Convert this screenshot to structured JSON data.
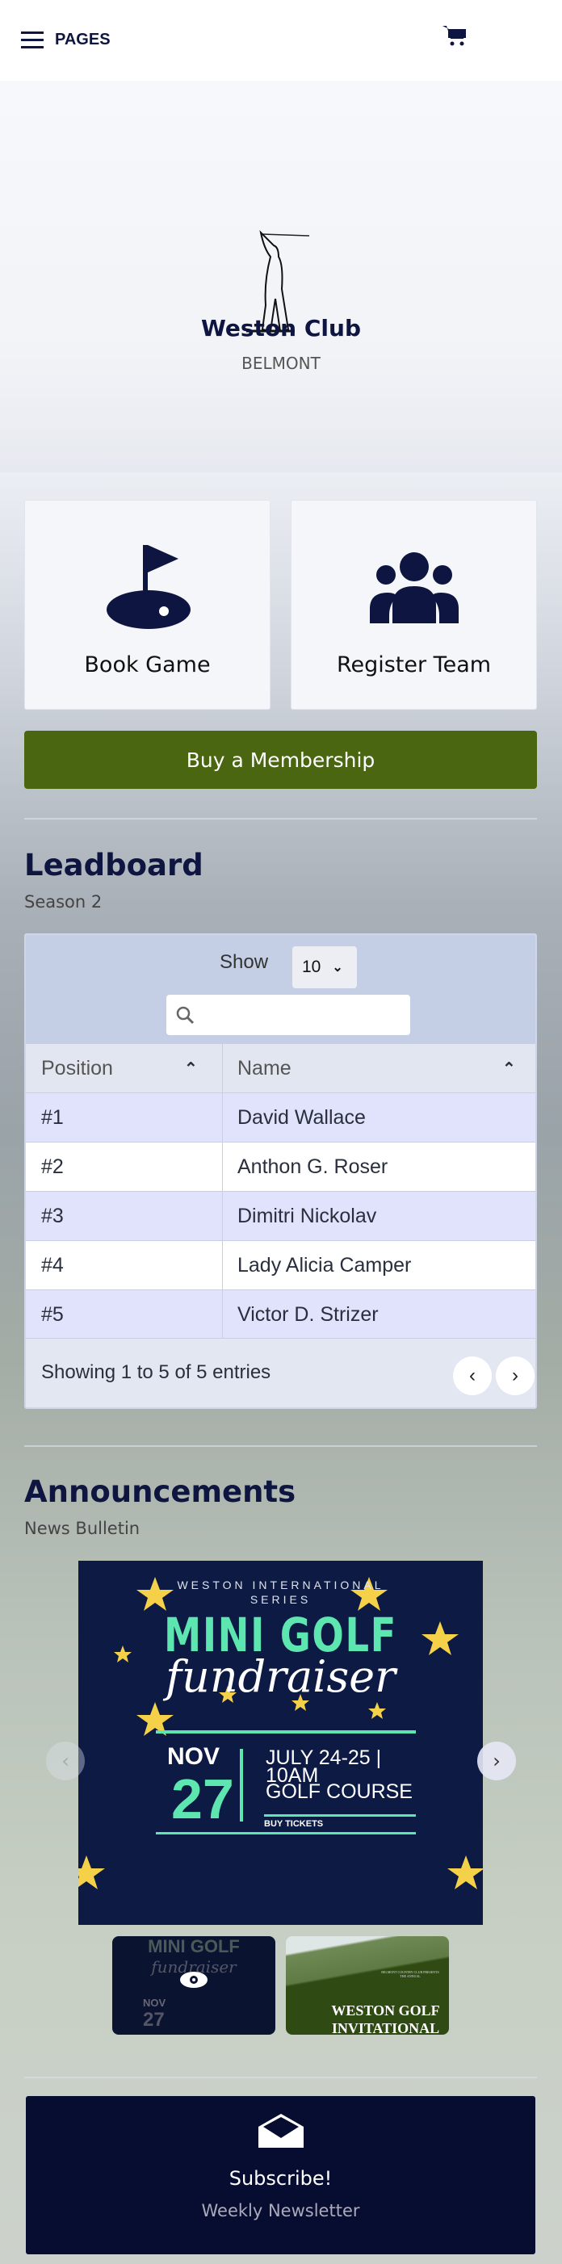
{
  "header": {
    "menu_label": "PAGES",
    "menu_icon": "hamburger-icon",
    "cart_icon": "cart-icon"
  },
  "hero": {
    "title": "Weston Club",
    "subtitle": "BELMONT"
  },
  "actions": [
    {
      "label": "Book Game",
      "icon": "golf-flag-icon"
    },
    {
      "label": "Register Team",
      "icon": "users-icon"
    }
  ],
  "membership_button": "Buy a Membership",
  "leaderboard": {
    "title": "Leadboard",
    "subtitle": "Season 2",
    "show_label": "Show",
    "page_size": "10",
    "search_placeholder": "",
    "columns": [
      "Position",
      "Name"
    ],
    "rows": [
      [
        "#1",
        "David Wallace"
      ],
      [
        "#2",
        "Anthon G. Roser"
      ],
      [
        "#3",
        "Dimitri Nickolav"
      ],
      [
        "#4",
        "Lady Alicia Camper"
      ],
      [
        "#5",
        "Victor D. Strizer"
      ]
    ],
    "info": "Showing 1 to 5 of 5 entries"
  },
  "announcements": {
    "title": "Announcements",
    "subtitle": "News Bulletin",
    "poster": {
      "series": "WESTON INTERNATIONAL",
      "series2": "SERIES",
      "headline": "MINI GOLF",
      "script": "fundraiser",
      "month": "NOV",
      "day": "27",
      "line1": "JULY 24-25 |",
      "line2": "10AM",
      "line3": "GOLF COURSE",
      "cta": "BUY TICKETS"
    },
    "thumbs": [
      {
        "title": "MINI GOLF",
        "script": "fundraiser",
        "month": "NOV",
        "day": "27"
      },
      {
        "kicker": "BELMONT COUNTRY CLUB PRESENTS THE ANNUAL",
        "title": "WESTON GOLF",
        "title2": "INVITATIONAL"
      }
    ]
  },
  "subscribe": {
    "title": "Subscribe!",
    "subtitle": "Weekly Newsletter",
    "icon": "envelope-open-icon"
  },
  "colors": {
    "navy": "#0d1540",
    "green": "#4a6610",
    "mint": "#5ee6b0",
    "star": "#f5d14a"
  }
}
